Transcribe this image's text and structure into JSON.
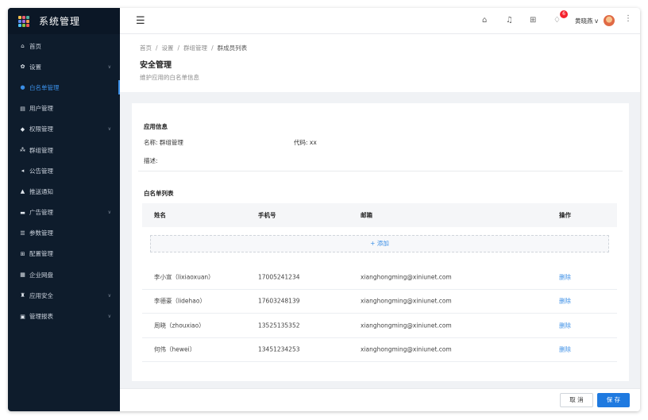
{
  "app": {
    "title": "系统管理"
  },
  "sidebar": {
    "items": [
      {
        "label": "首页",
        "icon": "home-icon",
        "glyph": "⌂",
        "chevron": false,
        "active": false
      },
      {
        "label": "设置",
        "icon": "gear-icon",
        "glyph": "✿",
        "chevron": true,
        "active": false
      },
      {
        "label": "白名单管理",
        "icon": "user-circle-icon",
        "glyph": "●",
        "chevron": false,
        "active": true
      },
      {
        "label": "用户管理",
        "icon": "user-card-icon",
        "glyph": "▤",
        "chevron": false,
        "active": false
      },
      {
        "label": "权限管理",
        "icon": "shield-icon",
        "glyph": "◆",
        "chevron": true,
        "active": false
      },
      {
        "label": "群组管理",
        "icon": "group-icon",
        "glyph": "⁂",
        "chevron": false,
        "active": false
      },
      {
        "label": "公告管理",
        "icon": "megaphone-icon",
        "glyph": "◂",
        "chevron": false,
        "active": false
      },
      {
        "label": "推送通知",
        "icon": "bell-icon",
        "glyph": "▲",
        "chevron": false,
        "active": false
      },
      {
        "label": "广告管理",
        "icon": "ad-icon",
        "glyph": "▬",
        "chevron": true,
        "active": false
      },
      {
        "label": "参数管理",
        "icon": "list-icon",
        "glyph": "☰",
        "chevron": false,
        "active": false
      },
      {
        "label": "配置管理",
        "icon": "config-icon",
        "glyph": "⊞",
        "chevron": false,
        "active": false
      },
      {
        "label": "企业网盘",
        "icon": "grid-icon",
        "glyph": "▦",
        "chevron": false,
        "active": false
      },
      {
        "label": "应用安全",
        "icon": "lock-icon",
        "glyph": "♜",
        "chevron": true,
        "active": false
      },
      {
        "label": "管理报表",
        "icon": "report-icon",
        "glyph": "▣",
        "chevron": true,
        "active": false
      }
    ]
  },
  "topbar": {
    "notification_count": "6",
    "username": "黄晓燕",
    "username_suffix": "v"
  },
  "header": {
    "breadcrumb": [
      "首页",
      "设置",
      "群组管理",
      "群成员列表"
    ],
    "title": "安全管理",
    "description": "维护应用的白名单信息"
  },
  "app_info": {
    "section_title": "应用信息",
    "name_label": "名称:",
    "name_value": "群组管理",
    "code_label": "代码:",
    "code_value": "xx",
    "desc_label": "描述:"
  },
  "whitelist": {
    "section_title": "白名单列表",
    "columns": [
      "姓名",
      "手机号",
      "邮箱",
      "操作"
    ],
    "add_label": "+ 添加",
    "rows": [
      {
        "name": "李小宣（lixiaoxuan）",
        "phone": "17005241234",
        "email": "xianghongming@xiniunet.com",
        "action": "删除"
      },
      {
        "name": "李德豪（lidehao）",
        "phone": "17603248139",
        "email": "xianghongming@xiniunet.com",
        "action": "删除"
      },
      {
        "name": "周晓（zhouxiao）",
        "phone": "13525135352",
        "email": "xianghongming@xiniunet.com",
        "action": "删除"
      },
      {
        "name": "何伟（hewei）",
        "phone": "13451234253",
        "email": "xianghongming@xiniunet.com",
        "action": "删除"
      }
    ]
  },
  "footer": {
    "cancel_label": "取 消",
    "save_label": "保 存"
  },
  "colors": {
    "sidebar_bg": "#0e1c2c",
    "accent": "#1f7ae0",
    "link": "#3a8ee6",
    "badge": "#f5222d"
  }
}
